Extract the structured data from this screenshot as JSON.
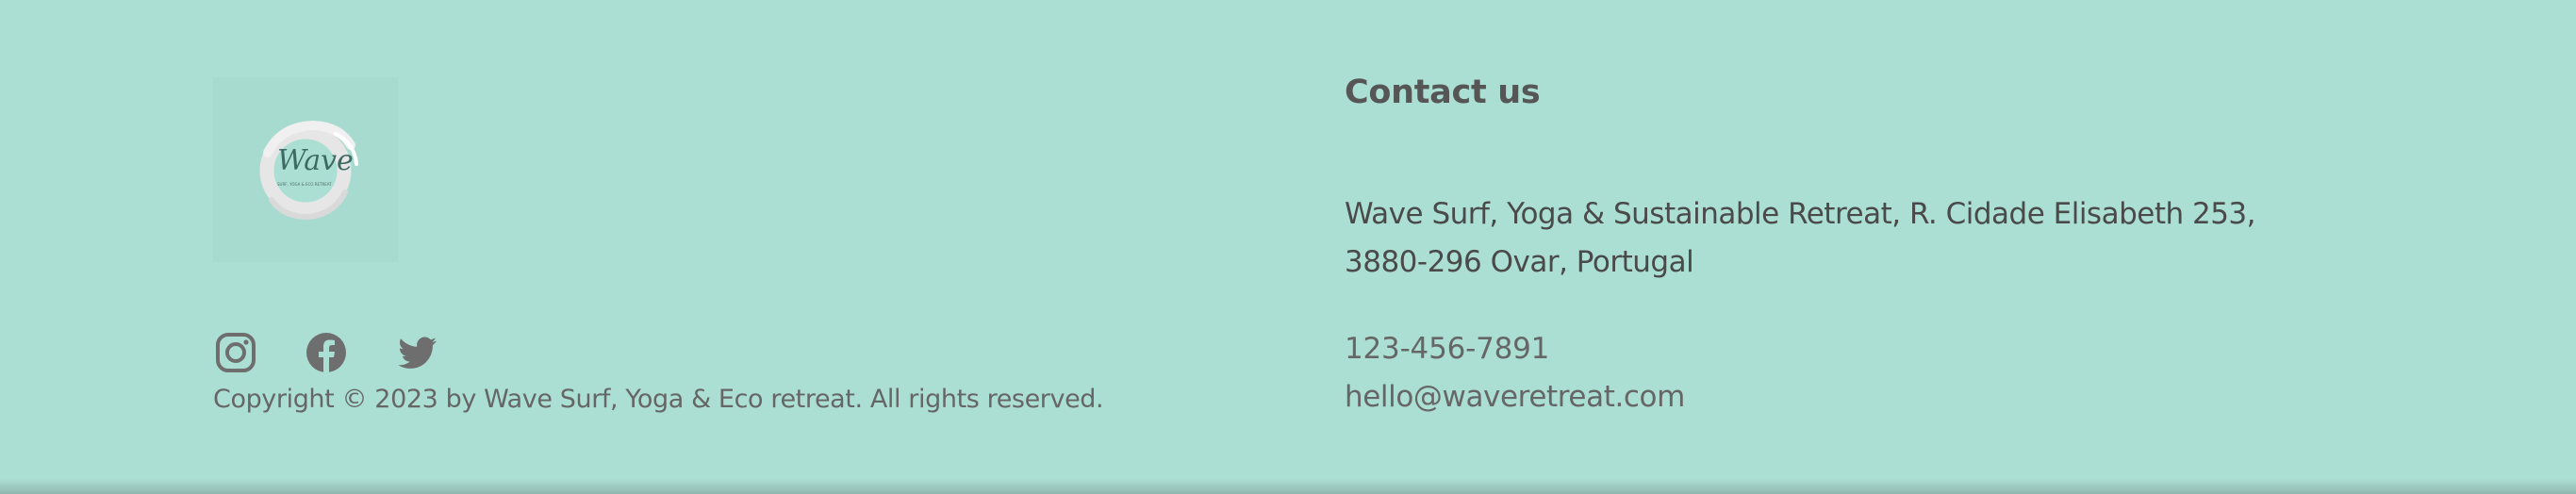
{
  "footer": {
    "logo": {
      "name": "Wave",
      "tagline": "SURF, YOGA & ECO RETREAT",
      "icon": "brush-circle-logo"
    },
    "social": [
      {
        "name": "Instagram",
        "icon": "instagram-icon"
      },
      {
        "name": "Facebook",
        "icon": "facebook-icon"
      },
      {
        "name": "Twitter",
        "icon": "twitter-icon"
      }
    ],
    "copyright": "Copyright © 2023 by Wave Surf, Yoga & Eco retreat. All rights reserved.",
    "contact": {
      "title": "Contact us",
      "address": "Wave Surf, Yoga & Sustainable Retreat, R. Cidade Elisabeth 253, 3880-296 Ovar, Portugal",
      "phone": "123-456-7891",
      "email": "hello@waveretreat.com"
    }
  },
  "colors": {
    "background": "#acdfd4",
    "heading": "#565656",
    "body_text": "#4a4a4a",
    "muted_text": "#666666",
    "icon": "#6e6e6e"
  }
}
